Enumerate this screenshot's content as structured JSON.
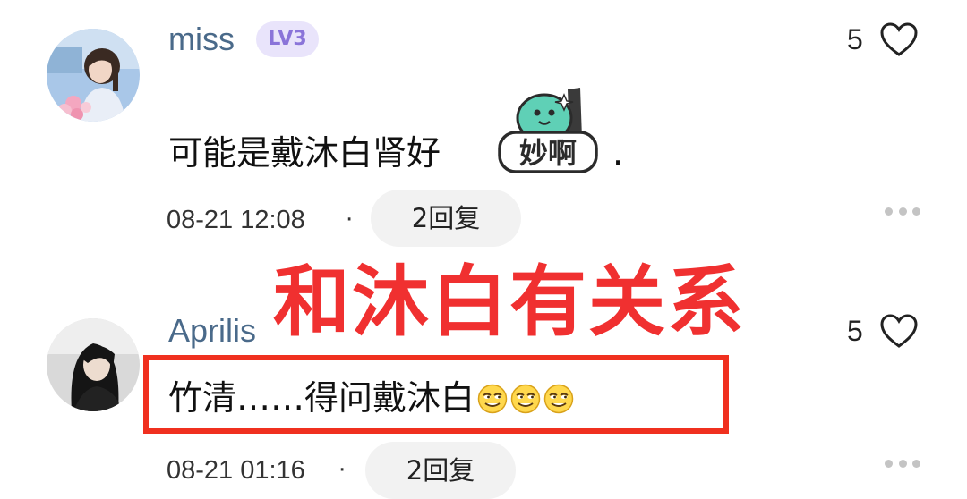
{
  "comments": [
    {
      "username": "miss",
      "level": "LV3",
      "likes": "5",
      "text": "可能是戴沐白肾好",
      "text_suffix": ".",
      "sticker_label": "妙啊",
      "time": "08-21 12:08",
      "dot": "·",
      "replies": "2回复"
    },
    {
      "username": "Aprilis",
      "likes": "5",
      "text": "竹清……得问戴沐白",
      "time": "08-21 01:16",
      "dot": "·",
      "replies": "2回复"
    }
  ],
  "overlay": {
    "title": "和沐白有关系"
  },
  "colors": {
    "overlay_red": "#f03030",
    "box_red": "#f0301f",
    "username": "#4a6a8a",
    "badge_bg": "#e9e4fb",
    "badge_text": "#8a74d9"
  },
  "icons": [
    "heart-icon",
    "more-dots-icon",
    "smirk-emoji",
    "miaoa-sticker"
  ]
}
